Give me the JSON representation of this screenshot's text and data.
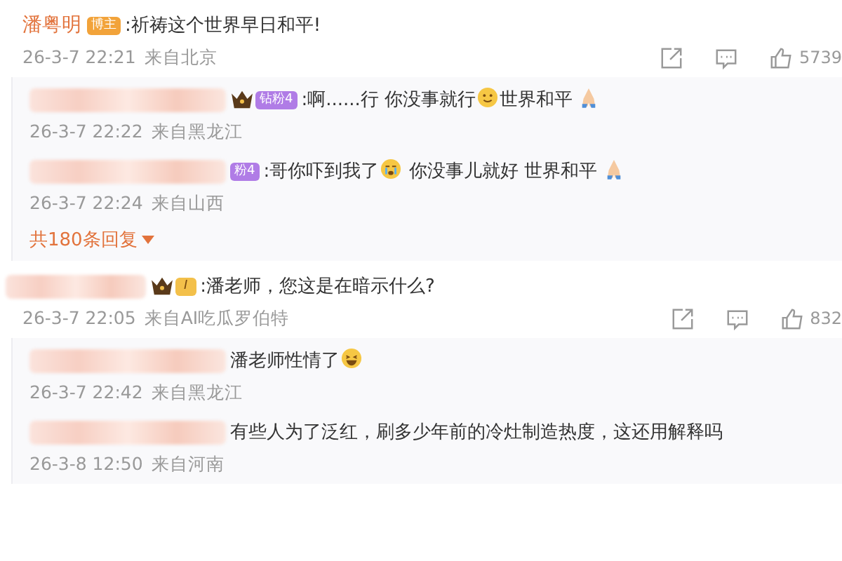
{
  "comments": [
    {
      "name": "潘粤明",
      "name_redacted": false,
      "badge": {
        "kind": "host",
        "text": "博主"
      },
      "crown": false,
      "content": [
        {
          "kind": "text",
          "text": ":祈祷这个世界早日和平!"
        }
      ],
      "time": "26-3-7 22:21",
      "location": "来自北京",
      "likes": "5739",
      "replies": [
        {
          "name_redacted": true,
          "crown": true,
          "badge": {
            "kind": "fan",
            "text": "钻粉4"
          },
          "content": [
            {
              "kind": "text",
              "text": ":啊......行 你没事就行"
            },
            {
              "kind": "smile"
            },
            {
              "kind": "text",
              "text": "世界和平 "
            },
            {
              "kind": "pray"
            }
          ],
          "time": "26-3-7 22:22",
          "location": "来自黑龙江"
        },
        {
          "name_redacted": true,
          "crown": false,
          "badge": {
            "kind": "fan",
            "text": "粉4"
          },
          "content": [
            {
              "kind": "text",
              "text": ":哥你吓到我了"
            },
            {
              "kind": "cry"
            },
            {
              "kind": "text",
              "text": " 你没事儿就好 世界和平 "
            },
            {
              "kind": "pray"
            }
          ],
          "time": "26-3-7 22:24",
          "location": "来自山西"
        }
      ],
      "more": "共180条回复"
    },
    {
      "name_redacted": true,
      "badge": {
        "kind": "level",
        "text": "I"
      },
      "crown": true,
      "content": [
        {
          "kind": "text",
          "text": ":潘老师，您这是在暗示什么?"
        }
      ],
      "time": "26-3-7 22:05",
      "location": "来自AI吃瓜罗伯特",
      "likes": "832",
      "replies": [
        {
          "name_redacted": true,
          "crown": false,
          "content": [
            {
              "kind": "text",
              "text": "潘老师性情了"
            },
            {
              "kind": "laugh"
            }
          ],
          "time": "26-3-7 22:42",
          "location": "来自黑龙江"
        },
        {
          "name_redacted": true,
          "crown": false,
          "content": [
            {
              "kind": "text",
              "text": "有些人为了泛红，刷多少年前的冷灶制造热度，这还用解释吗"
            }
          ],
          "time": "26-3-8 12:50",
          "location": "来自河南"
        }
      ]
    }
  ]
}
